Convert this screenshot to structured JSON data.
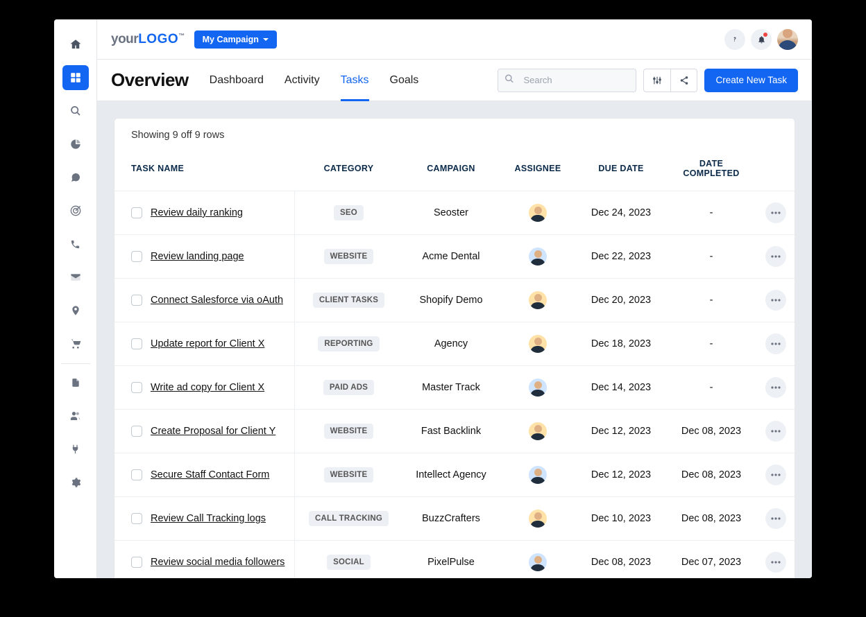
{
  "brand": {
    "part1": "your",
    "part2": "LOGO",
    "tm": "™"
  },
  "header": {
    "campaign_button": "My Campaign"
  },
  "secondbar": {
    "title": "Overview",
    "tabs": [
      {
        "label": "Dashboard",
        "active": false
      },
      {
        "label": "Activity",
        "active": false
      },
      {
        "label": "Tasks",
        "active": true
      },
      {
        "label": "Goals",
        "active": false
      }
    ],
    "search_placeholder": "Search",
    "create_button": "Create New Task"
  },
  "table": {
    "status": "Showing 9 off 9 rows",
    "headers": {
      "task": "TASK NAME",
      "category": "CATEGORY",
      "campaign": "CAMPAIGN",
      "assignee": "ASSIGNEE",
      "due": "DUE DATE",
      "completed": "DATE COMPLETED"
    },
    "rows": [
      {
        "task": "Review daily ranking",
        "category": "SEO",
        "campaign": "Seoster",
        "avatar": "gold",
        "due": "Dec 24, 2023",
        "completed": "-"
      },
      {
        "task": "Review landing page",
        "category": "WEBSITE",
        "campaign": "Acme Dental",
        "avatar": "blue",
        "due": "Dec 22, 2023",
        "completed": "-"
      },
      {
        "task": "Connect Salesforce via oAuth",
        "category": "CLIENT TASKS",
        "campaign": "Shopify Demo",
        "avatar": "gold",
        "due": "Dec 20, 2023",
        "completed": "-"
      },
      {
        "task": "Update report for Client X",
        "category": "REPORTING",
        "campaign": "Agency",
        "avatar": "gold",
        "due": "Dec 18, 2023",
        "completed": "-"
      },
      {
        "task": "Write ad copy for Client X",
        "category": "PAID ADS",
        "campaign": "Master Track",
        "avatar": "blue",
        "due": "Dec 14, 2023",
        "completed": "-"
      },
      {
        "task": "Create Proposal for Client Y",
        "category": "WEBSITE",
        "campaign": "Fast Backlink",
        "avatar": "gold",
        "due": "Dec 12, 2023",
        "completed": "Dec 08, 2023"
      },
      {
        "task": "Secure Staff Contact Form",
        "category": "WEBSITE",
        "campaign": "Intellect Agency",
        "avatar": "blue",
        "due": "Dec 12, 2023",
        "completed": "Dec 08, 2023"
      },
      {
        "task": "Review Call Tracking logs",
        "category": "CALL TRACKING",
        "campaign": "BuzzCrafters",
        "avatar": "gold",
        "due": "Dec 10, 2023",
        "completed": "Dec 08, 2023"
      },
      {
        "task": "Review social media followers",
        "category": "SOCIAL",
        "campaign": "PixelPulse",
        "avatar": "blue",
        "due": "Dec 08, 2023",
        "completed": "Dec 07, 2023"
      }
    ]
  }
}
